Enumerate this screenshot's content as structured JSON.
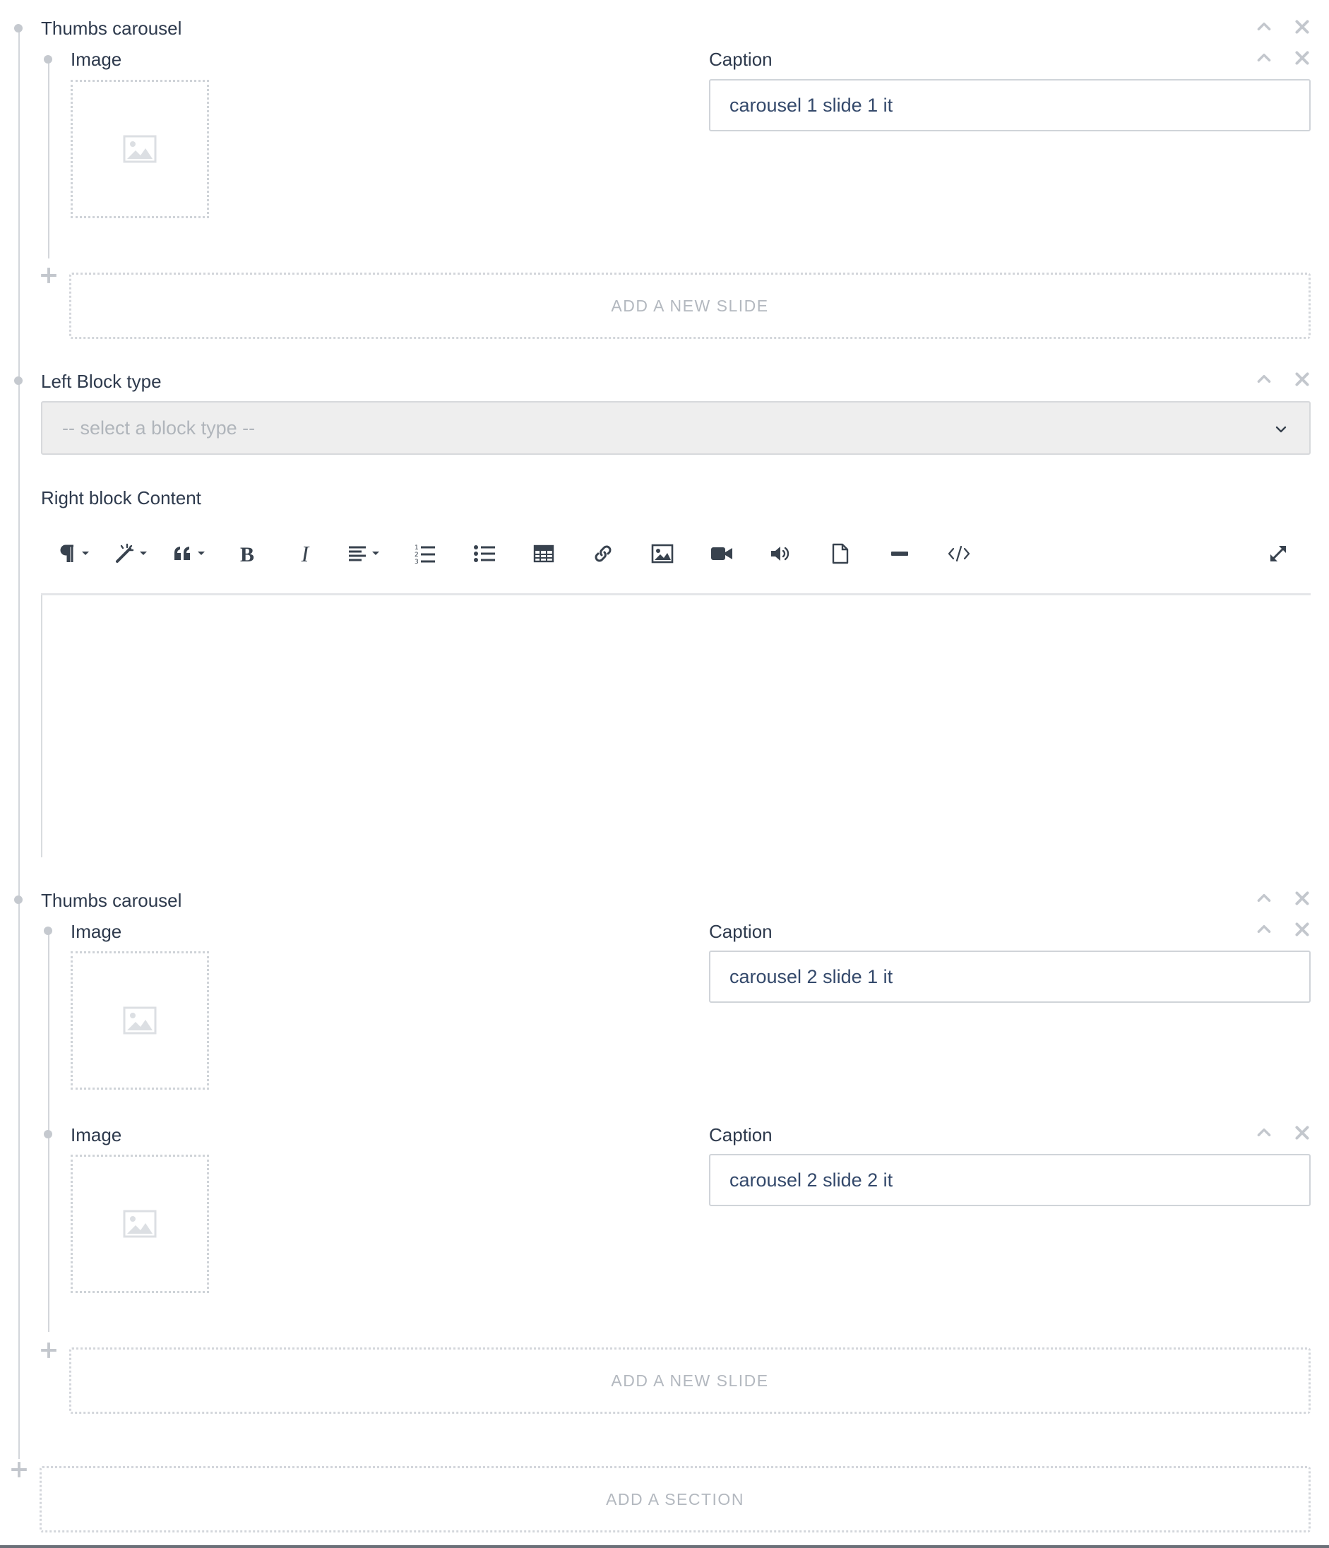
{
  "sections": [
    {
      "title": "Thumbs carousel",
      "slides": [
        {
          "image_label": "Image",
          "caption_label": "Caption",
          "caption_value": "carousel 1 slide 1 it"
        }
      ],
      "add_slide_label": "ADD A NEW SLIDE"
    },
    {
      "left_block_label": "Left Block type",
      "left_block_placeholder": "-- select a block type --",
      "right_block_label": "Right block Content",
      "toolbar_icons": [
        "paragraph-icon",
        "magic-wand-icon",
        "quote-icon",
        "bold-icon",
        "italic-icon",
        "align-icon",
        "ordered-list-icon",
        "unordered-list-icon",
        "table-icon",
        "link-icon",
        "image-icon",
        "video-icon",
        "audio-icon",
        "file-icon",
        "horizontal-rule-icon",
        "code-view-icon",
        "fullscreen-icon"
      ]
    },
    {
      "title": "Thumbs carousel",
      "slides": [
        {
          "image_label": "Image",
          "caption_label": "Caption",
          "caption_value": "carousel 2 slide 1 it"
        },
        {
          "image_label": "Image",
          "caption_label": "Caption",
          "caption_value": "carousel 2 slide 2 it"
        }
      ],
      "add_slide_label": "ADD A NEW SLIDE"
    }
  ],
  "add_section_label": "ADD A SECTION",
  "colors": {
    "text": "#2e3a4d",
    "input_text": "#34496b",
    "muted": "#b3b8bf",
    "line": "#d3d6db",
    "select_bg": "#eeeeee"
  }
}
